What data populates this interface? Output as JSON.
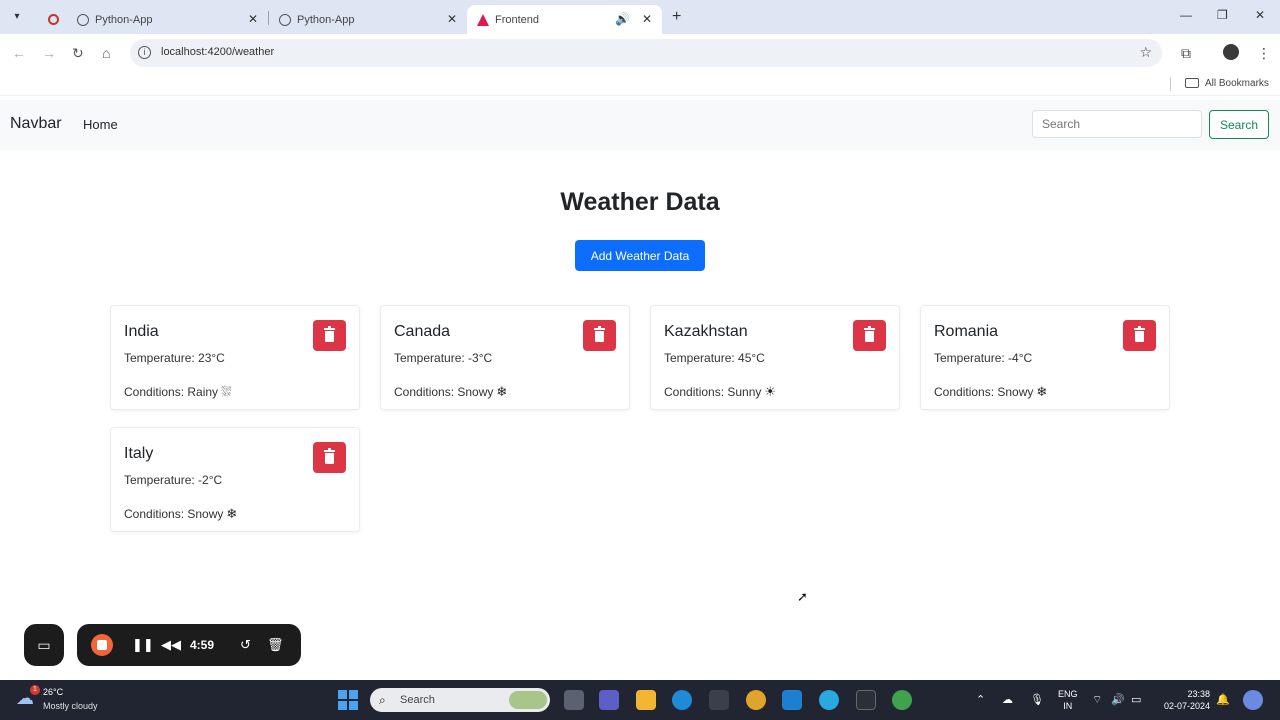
{
  "browser": {
    "tabs": [
      {
        "title": "Python-App"
      },
      {
        "title": "Python-App"
      },
      {
        "title": "Frontend",
        "active": true
      }
    ],
    "url": "localhost:4200/weather",
    "bookmarks_label": "All Bookmarks"
  },
  "navbar": {
    "brand": "Navbar",
    "links": [
      "Home"
    ],
    "search_placeholder": "Search",
    "search_button": "Search"
  },
  "main": {
    "title": "Weather Data",
    "add_button": "Add Weather Data",
    "cards": [
      {
        "city": "India",
        "temperature": "Temperature: 23°C",
        "conditions": "Conditions: Rainy",
        "icon": "rain-cloud-icon",
        "glyph": "⛆"
      },
      {
        "city": "Canada",
        "temperature": "Temperature: -3°C",
        "conditions": "Conditions: Snowy",
        "icon": "snowflake-icon",
        "glyph": "❄"
      },
      {
        "city": "Kazakhstan",
        "temperature": "Temperature: 45°C",
        "conditions": "Conditions: Sunny",
        "icon": "sun-icon",
        "glyph": "☀"
      },
      {
        "city": "Romania",
        "temperature": "Temperature: -4°C",
        "conditions": "Conditions: Snowy",
        "icon": "snowflake-icon",
        "glyph": "❄"
      },
      {
        "city": "Italy",
        "temperature": "Temperature: -2°C",
        "conditions": "Conditions: Snowy",
        "icon": "snowflake-icon",
        "glyph": "❄"
      }
    ]
  },
  "recorder": {
    "time": "4:59"
  },
  "taskbar": {
    "weather_badge": "1",
    "weather_temp": "26°C",
    "weather_cond": "Mostly cloudy",
    "search_label": "Search",
    "lang_top": "ENG",
    "lang_bottom": "IN",
    "time": "23:38",
    "date": "02-07-2024"
  },
  "colors": {
    "primary": "#0d6efd",
    "danger": "#dc3545",
    "success": "#198754"
  }
}
